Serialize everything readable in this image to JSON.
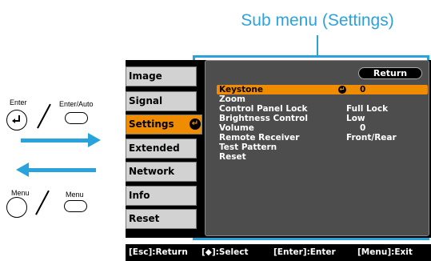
{
  "callout": {
    "title": "Sub menu (Settings)"
  },
  "instructions": {
    "enter_label": "Enter",
    "enter_auto_label": "Enter/Auto",
    "menu_label": "Menu",
    "menu_small_label": "Menu"
  },
  "main_menu": {
    "tabs": [
      {
        "label": "Image"
      },
      {
        "label": "Signal"
      },
      {
        "label": "Settings",
        "selected": true
      },
      {
        "label": "Extended"
      },
      {
        "label": "Network"
      },
      {
        "label": "Info"
      },
      {
        "label": "Reset"
      }
    ]
  },
  "sub_menu": {
    "return_label": "Return",
    "items": [
      {
        "label": "Keystone",
        "value": "0",
        "selected": true
      },
      {
        "label": "Zoom",
        "value": ""
      },
      {
        "label": "Control Panel Lock",
        "value": "Full Lock"
      },
      {
        "label": "Brightness Control",
        "value": "Low"
      },
      {
        "label": "Volume",
        "value": "0"
      },
      {
        "label": "Remote Receiver",
        "value": "Front/Rear"
      },
      {
        "label": "Test Pattern",
        "value": ""
      },
      {
        "label": "Reset",
        "value": ""
      }
    ]
  },
  "footer": {
    "esc": "[Esc]:Return",
    "select": "[◆]:Select",
    "enter": "[Enter]:Enter",
    "menu": "[Menu]:Exit"
  },
  "colors": {
    "accent": "#f08c00",
    "callout": "#2aa3dd",
    "panel": "#4d4d4d",
    "tab": "#d2d2d2"
  }
}
